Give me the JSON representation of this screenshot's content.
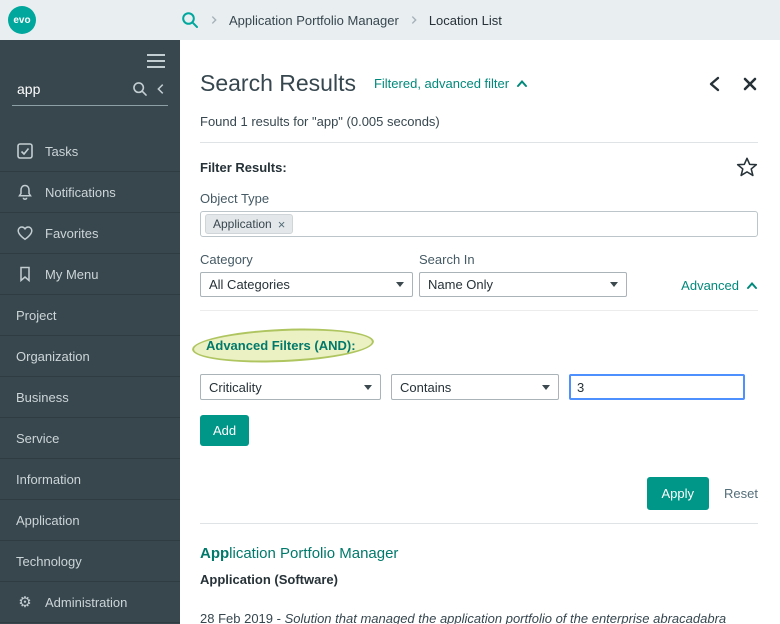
{
  "header": {
    "logo_text": "evo",
    "breadcrumb": [
      {
        "label": "Application Portfolio Manager"
      },
      {
        "label": "Location List"
      }
    ]
  },
  "sidebar": {
    "search_value": "app",
    "items": [
      {
        "label": "Tasks"
      },
      {
        "label": "Notifications"
      },
      {
        "label": "Favorites"
      },
      {
        "label": "My Menu"
      },
      {
        "label": "Project"
      },
      {
        "label": "Organization"
      },
      {
        "label": "Business"
      },
      {
        "label": "Service"
      },
      {
        "label": "Information"
      },
      {
        "label": "Application"
      },
      {
        "label": "Technology"
      },
      {
        "label": "Administration"
      }
    ]
  },
  "main": {
    "title": "Search Results",
    "filter_state_link": "Filtered, advanced filter",
    "results_summary": "Found 1 results for \"app\" (0.005 seconds)",
    "filters": {
      "heading": "Filter Results:",
      "object_type_label": "Object Type",
      "object_type_chip": "Application",
      "category_label": "Category",
      "category_value": "All Categories",
      "search_in_label": "Search In",
      "search_in_value": "Name Only",
      "advanced_link": "Advanced",
      "advanced_heading": "Advanced Filters (AND):",
      "field_value": "Criticality",
      "operator_value": "Contains",
      "criteria_value": "3",
      "add_button": "Add",
      "apply_button": "Apply",
      "reset_link": "Reset"
    },
    "result": {
      "title_match": "App",
      "title_rest": "lication Portfolio Manager",
      "type": "Application (Software)",
      "date": "28 Feb 2019 - ",
      "description": "Solution that managed the application portfolio of the enterprise abracadabra"
    }
  },
  "icons": {
    "gear_glyph": "⚙",
    "chip_remove_glyph": "×"
  },
  "colors": {
    "accent": "#009688",
    "link": "#00897b",
    "sidebar_bg": "#37474d",
    "header_bg": "#e9eef1",
    "highlight_fill": "#d3e07a",
    "highlight_border": "#a4bd4f",
    "focus_border": "#4d90fe"
  }
}
